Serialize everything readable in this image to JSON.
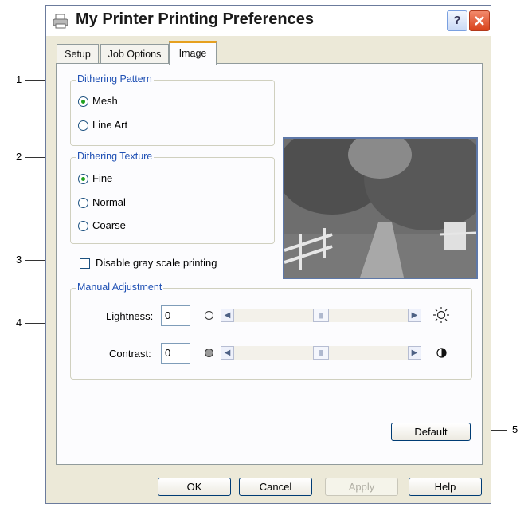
{
  "window": {
    "title": "My Printer Printing Preferences"
  },
  "tabs": [
    {
      "label": "Setup"
    },
    {
      "label": "Job Options"
    },
    {
      "label": "Image",
      "active": true
    }
  ],
  "dithering_pattern": {
    "legend": "Dithering Pattern",
    "options": [
      {
        "label": "Mesh",
        "selected": true
      },
      {
        "label": "Line Art",
        "selected": false
      }
    ]
  },
  "dithering_texture": {
    "legend": "Dithering Texture",
    "options": [
      {
        "label": "Fine",
        "selected": true
      },
      {
        "label": "Normal",
        "selected": false
      },
      {
        "label": "Coarse",
        "selected": false
      }
    ]
  },
  "disable_grayscale": {
    "label": "Disable gray scale printing",
    "checked": false
  },
  "manual_adjustment": {
    "legend": "Manual Adjustment",
    "lightness": {
      "label": "Lightness:",
      "value": "0"
    },
    "contrast": {
      "label": "Contrast:",
      "value": "0"
    }
  },
  "buttons": {
    "default": "Default",
    "ok": "OK",
    "cancel": "Cancel",
    "apply": "Apply",
    "help": "Help"
  },
  "callouts": [
    "1",
    "2",
    "3",
    "4",
    "5"
  ],
  "colors": {
    "accent": "#1f50b4",
    "tab_highlight": "#e6a01f",
    "radio_dot": "#21a121"
  }
}
